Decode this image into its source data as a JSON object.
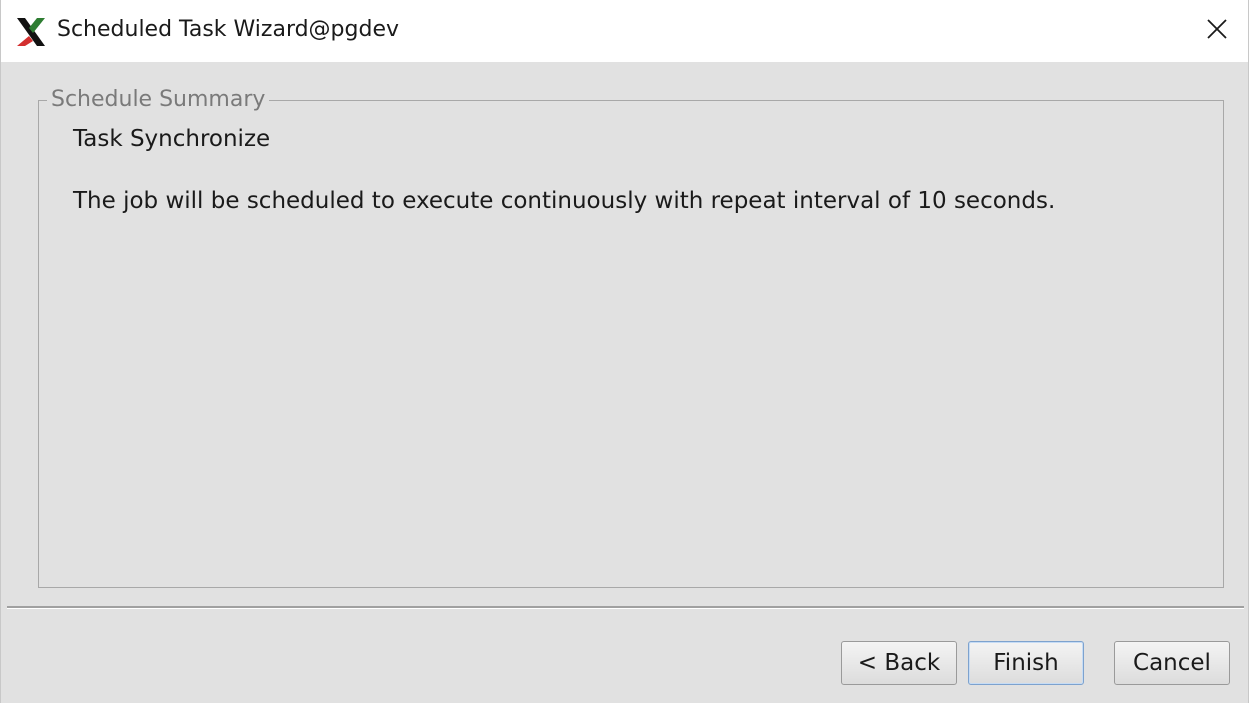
{
  "window": {
    "title": "Scheduled Task Wizard@pgdev",
    "app_icon": "x-app-icon",
    "close_icon": "close-icon"
  },
  "summary": {
    "legend": "Schedule Summary",
    "task_name": "Task Synchronize",
    "description": "The job will be scheduled to execute continuously with repeat interval of 10 seconds."
  },
  "buttons": {
    "back": "< Back",
    "finish": "Finish",
    "cancel": "Cancel"
  },
  "colors": {
    "background": "#e1e1e1",
    "titlebar": "#ffffff",
    "focus_border": "#7da2ce"
  }
}
